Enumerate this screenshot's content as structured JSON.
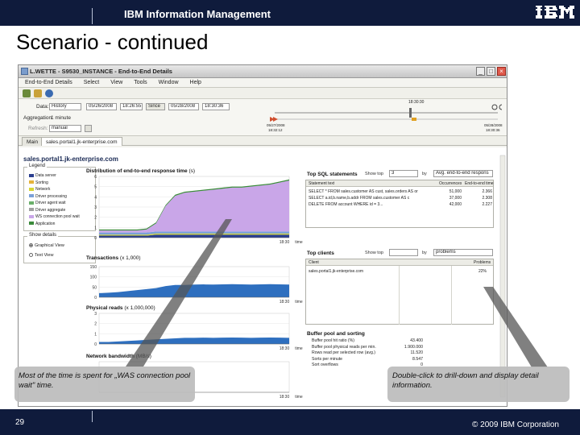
{
  "slide": {
    "header_brand": "IBM Information Management",
    "title": "Scenario - continued",
    "page_number": "29",
    "copyright": "© 2009 IBM Corporation",
    "logo_text": "IBM"
  },
  "window": {
    "title": "L.WETTE - S9530_INSTANCE - End-to-End Details",
    "menu": [
      "End-to-End Details",
      "Select",
      "View",
      "Tools",
      "Window",
      "Help"
    ],
    "filters": {
      "data_label": "Data:",
      "data_value": "History",
      "from_date": "05/26/2008",
      "from_time": "18:26:55",
      "since_button": "Since",
      "to_date": "05/28/2008",
      "to_time": "18:30:36",
      "aggregation_label": "Aggregation:",
      "aggregation_value": "1 minute",
      "refresh_label": "Refresh:",
      "refresh_value": "manual",
      "timeline_marker": "18:30:30",
      "timeline_start_date": "05/27/2008",
      "timeline_start_time": "18:32:12",
      "timeline_end_date": "05/28/2008",
      "timeline_end_time": "18:30:36"
    },
    "tabs": [
      "Main",
      "sales.portal1.jk-enterprise.com"
    ],
    "server": "sales.portal1.jk-enterprise.com",
    "legend": {
      "title": "Legend",
      "items": [
        {
          "label": "Data server",
          "color": "#2b3f8f"
        },
        {
          "label": "Sorting",
          "color": "#e5b33a"
        },
        {
          "label": "Network",
          "color": "#d6d634"
        },
        {
          "label": "Driver processing",
          "color": "#7aa0d8"
        },
        {
          "label": "Driver agent wait",
          "color": "#6ab06a"
        },
        {
          "label": "Driver aggregate",
          "color": "#a0a0a0"
        },
        {
          "label": "WS connection pool wait",
          "color": "#c9a6e8"
        },
        {
          "label": "Application",
          "color": "#3a8a3a"
        }
      ]
    },
    "show_details": {
      "title": "Show details",
      "options": [
        {
          "label": "Graphical View",
          "selected": true
        },
        {
          "label": "Text View",
          "selected": false
        }
      ]
    },
    "charts": {
      "response_time": {
        "title": "Distribution of end-to-end response time",
        "unit": "(s)",
        "y_ticks": [
          "6",
          "5",
          "4",
          "3",
          "2",
          "1",
          "0"
        ],
        "x_tick": "18:30",
        "x_label": "time"
      },
      "transactions": {
        "title": "Transactions",
        "unit": "(x 1,000)",
        "y_ticks": [
          "150",
          "100",
          "50",
          "0"
        ],
        "x_tick": "18:30",
        "x_label": "time"
      },
      "physical_reads": {
        "title": "Physical reads",
        "unit": "(x 1,000,000)",
        "y_ticks": [
          "3",
          "2",
          "1",
          "0"
        ],
        "x_tick": "18:30",
        "x_label": "time"
      },
      "network_bandwidth": {
        "title": "Network bandwidth",
        "unit": "(MB/s)",
        "x_tick": "18:30",
        "x_label": "time"
      }
    },
    "top_sql": {
      "title": "Top SQL statements",
      "show_top_label": "Show top",
      "show_top_value": "3",
      "by_label": "by",
      "by_value": "Avg. end-to-end respons",
      "columns": [
        "Statement text",
        "Occurrences",
        "End-to-end time"
      ],
      "rows": [
        {
          "text": "SELECT * FROM sales.customer AS cust, sales.orders AS or",
          "occ": "51,000",
          "time": "2.366"
        },
        {
          "text": "SELECT a.id,b.name,b.addr FROM sales.customer AS c",
          "occ": "37,000",
          "time": "2.308"
        },
        {
          "text": "DELETE FROM account WHERE id = 3...",
          "occ": "42,000",
          "time": "2.227"
        }
      ]
    },
    "top_clients": {
      "title": "Top clients",
      "show_top_label": "Show top",
      "show_top_value": "",
      "by_label": "by",
      "by_value": "problems",
      "columns": [
        "Client",
        "Problems"
      ],
      "rows": [
        {
          "client": "sales.portal1.jk-enterprise.com",
          "problems": "22%"
        }
      ]
    },
    "buffer_pool": {
      "title": "Buffer pool and sorting",
      "items": [
        {
          "label": "Buffer pool hit ratio (%)",
          "value": "43.400"
        },
        {
          "label": "Buffer pool physical reads per min.",
          "value": "1.900.000"
        },
        {
          "label": "Rows read per selected row (avg.)",
          "value": "11.520"
        },
        {
          "label": "Sorts per minute",
          "value": "8.547"
        },
        {
          "label": "Sort overflows",
          "value": "0"
        }
      ]
    }
  },
  "callouts": {
    "left": "Most of the time is spent for „WAS connection pool wait\" time.",
    "right": "Double-click to drill-down and display detail information."
  },
  "chart_data": [
    {
      "type": "area",
      "title": "Distribution of end-to-end response time",
      "ylabel": "(s)",
      "xlabel": "time",
      "ylim": [
        0,
        6
      ],
      "x": [
        0,
        1,
        2,
        3,
        4,
        5,
        6,
        7,
        8,
        9,
        10,
        11,
        12,
        13,
        14,
        15,
        16,
        17,
        18,
        19,
        20
      ],
      "series": [
        {
          "name": "Data server",
          "values": [
            0.2,
            0.2,
            0.2,
            0.2,
            0.2,
            0.2,
            0.3,
            0.3,
            0.3,
            0.3,
            0.3,
            0.3,
            0.3,
            0.3,
            0.3,
            0.3,
            0.3,
            0.3,
            0.3,
            0.3,
            0.3
          ]
        },
        {
          "name": "Network",
          "values": [
            0.1,
            0.1,
            0.1,
            0.1,
            0.1,
            0.1,
            0.1,
            0.1,
            0.1,
            0.1,
            0.1,
            0.1,
            0.1,
            0.1,
            0.1,
            0.1,
            0.1,
            0.1,
            0.1,
            0.1,
            0.1
          ]
        },
        {
          "name": "Driver processing",
          "values": [
            0.2,
            0.2,
            0.2,
            0.2,
            0.2,
            0.2,
            0.2,
            0.2,
            0.2,
            0.2,
            0.2,
            0.2,
            0.2,
            0.2,
            0.2,
            0.2,
            0.2,
            0.2,
            0.2,
            0.2,
            0.2
          ]
        },
        {
          "name": "WS connection pool wait",
          "values": [
            0.2,
            0.2,
            0.2,
            0.2,
            0.2,
            0.3,
            0.8,
            2.5,
            3.5,
            3.8,
            3.9,
            4.0,
            4.1,
            4.2,
            4.3,
            4.3,
            4.4,
            4.5,
            4.6,
            4.8,
            5.0
          ]
        },
        {
          "name": "Application",
          "values": [
            0.1,
            0.1,
            0.1,
            0.1,
            0.1,
            0.1,
            0.1,
            0.1,
            0.1,
            0.1,
            0.1,
            0.1,
            0.1,
            0.1,
            0.1,
            0.1,
            0.1,
            0.1,
            0.1,
            0.1,
            0.1
          ]
        }
      ]
    },
    {
      "type": "area",
      "title": "Transactions",
      "ylabel": "(x 1,000)",
      "xlabel": "time",
      "ylim": [
        0,
        150
      ],
      "x": [
        0,
        1,
        2,
        3,
        4,
        5,
        6,
        7,
        8,
        9,
        10,
        11,
        12,
        13,
        14,
        15,
        16,
        17,
        18,
        19,
        20
      ],
      "series": [
        {
          "name": "Transactions",
          "values": [
            20,
            22,
            25,
            30,
            35,
            40,
            45,
            55,
            60,
            60,
            62,
            63,
            62,
            63,
            64,
            63,
            62,
            63,
            64,
            63,
            62
          ]
        }
      ]
    },
    {
      "type": "area",
      "title": "Physical reads",
      "ylabel": "(x 1,000,000)",
      "xlabel": "time",
      "ylim": [
        0,
        3
      ],
      "x": [
        0,
        1,
        2,
        3,
        4,
        5,
        6,
        7,
        8,
        9,
        10,
        11,
        12,
        13,
        14,
        15,
        16,
        17,
        18,
        19,
        20
      ],
      "series": [
        {
          "name": "Physical reads",
          "values": [
            0.2,
            0.2,
            0.25,
            0.3,
            0.35,
            0.4,
            0.45,
            0.5,
            0.55,
            0.6,
            0.6,
            0.62,
            0.6,
            0.62,
            0.63,
            0.62,
            0.6,
            0.62,
            0.63,
            0.62,
            0.6
          ]
        }
      ]
    }
  ]
}
